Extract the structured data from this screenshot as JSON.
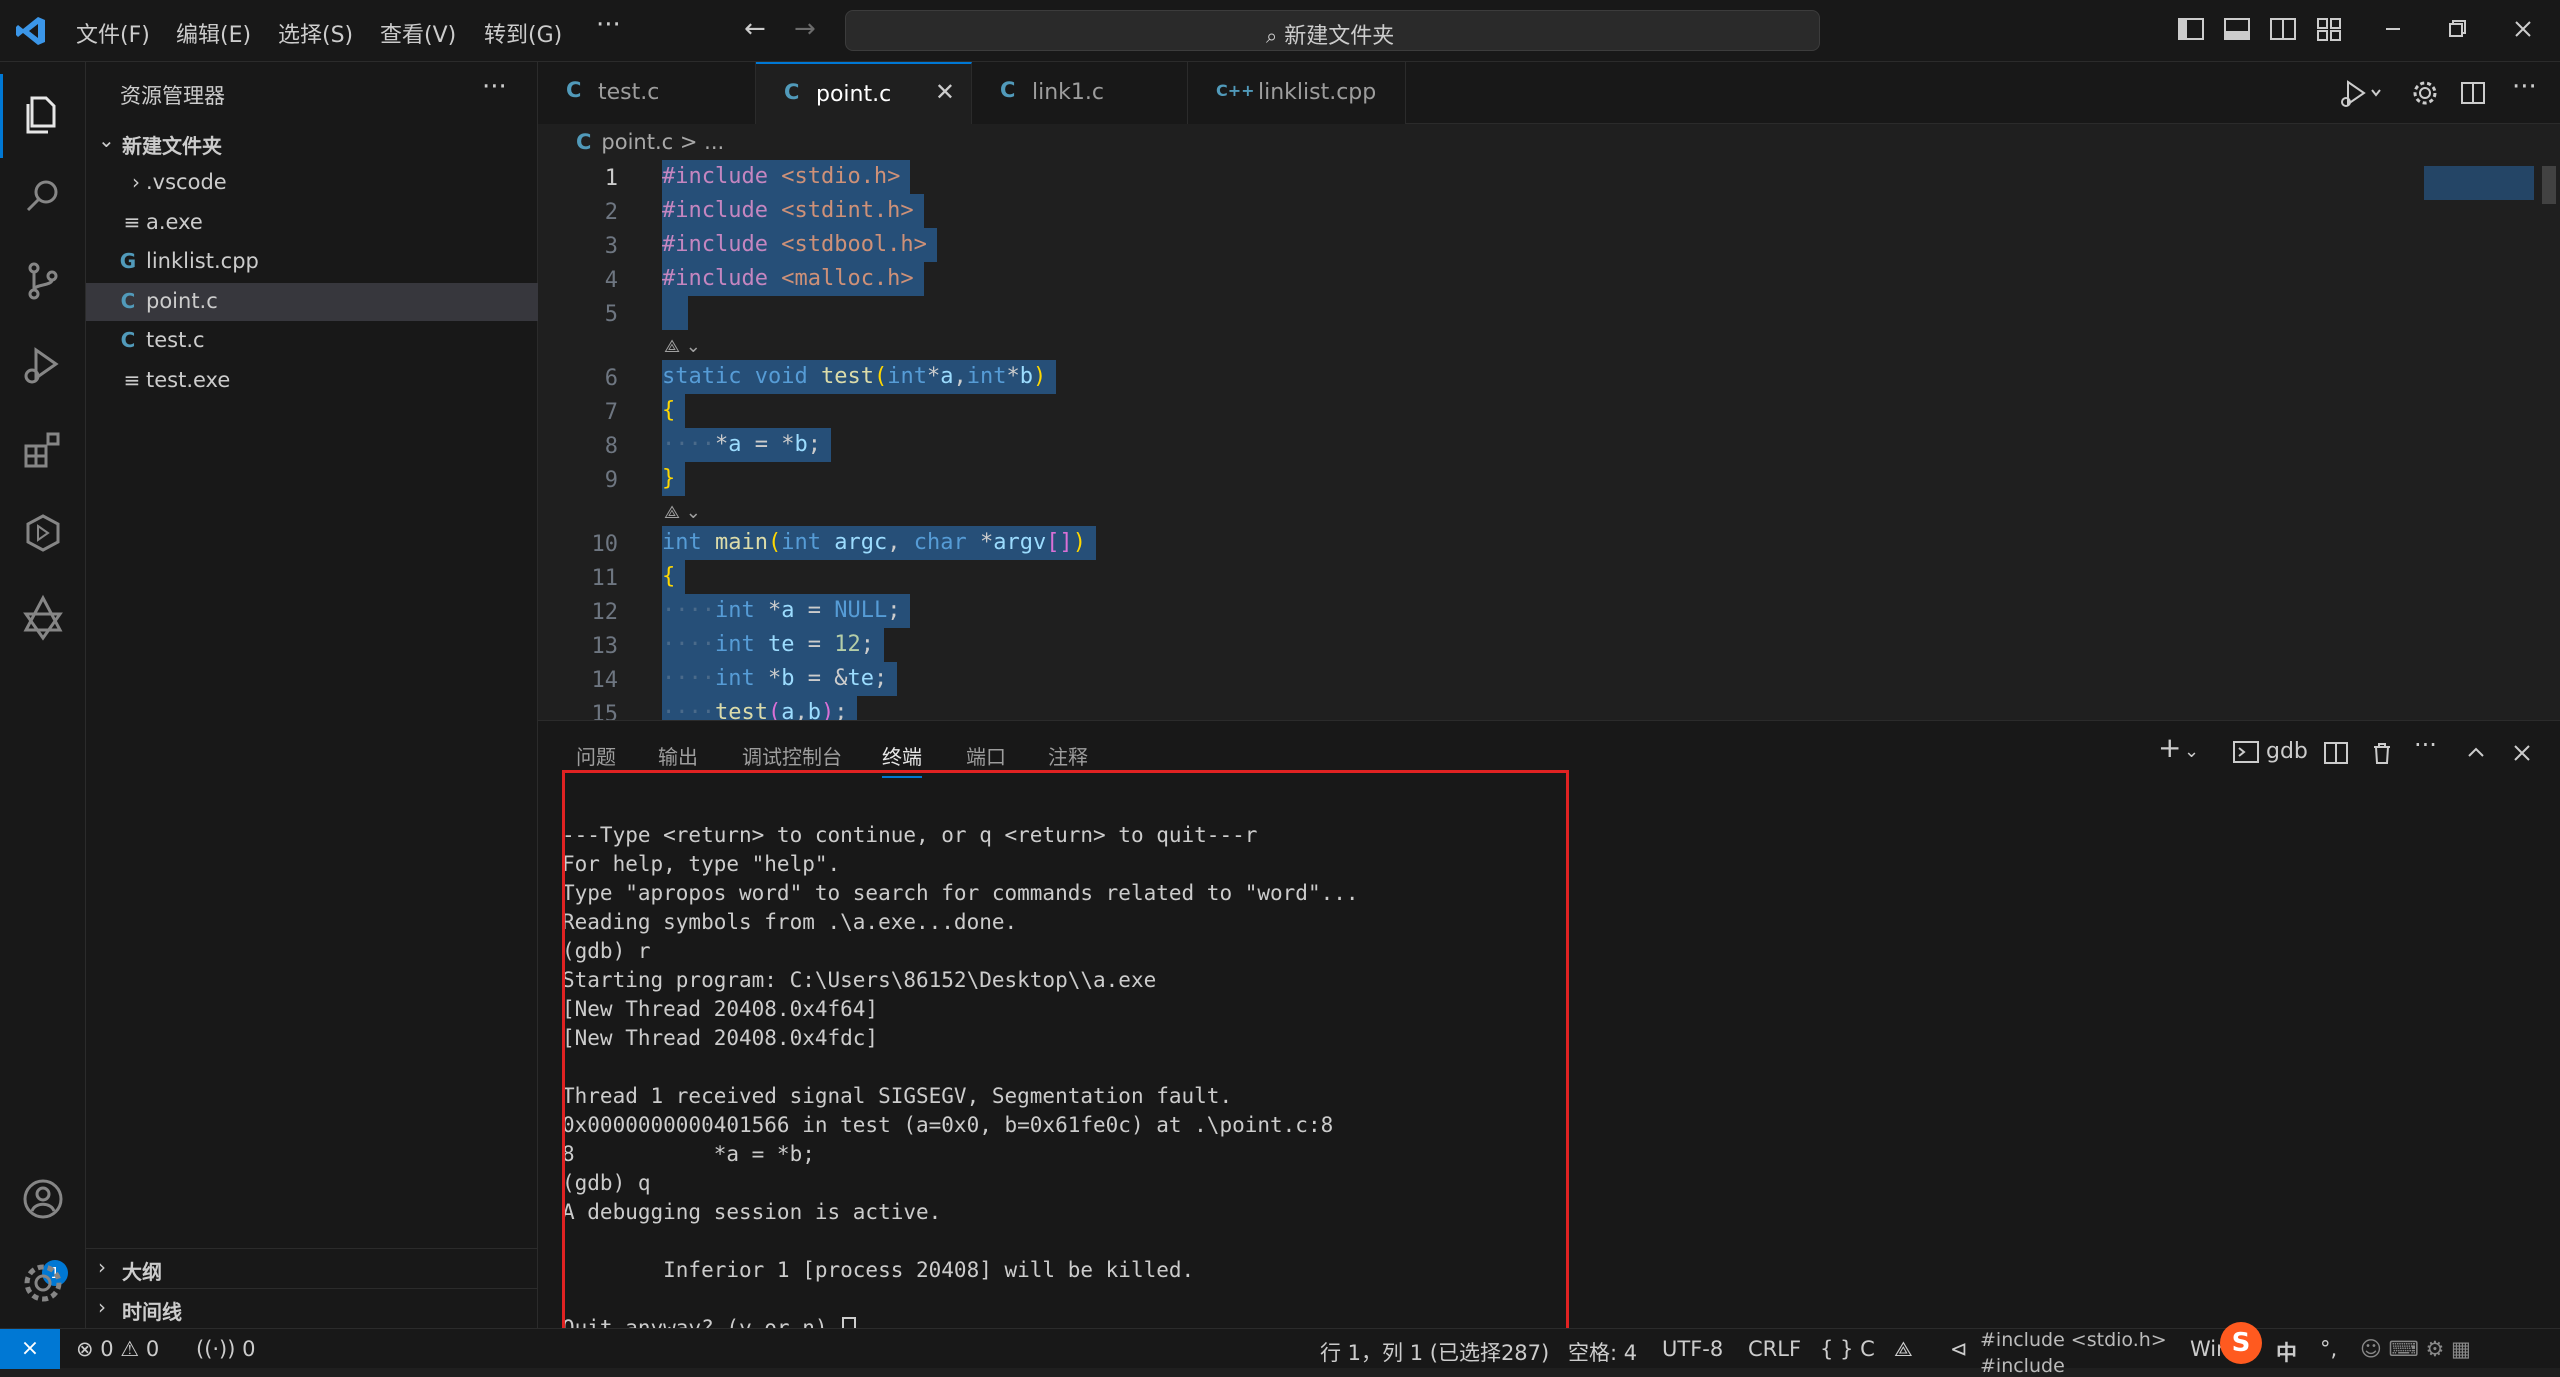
{
  "menu": [
    "文件(F)",
    "编辑(E)",
    "选择(S)",
    "查看(V)",
    "转到(G)"
  ],
  "search_text": "新建文件夹",
  "explorer": {
    "title": "资源管理器",
    "folder": "新建文件夹",
    "files": [
      {
        "name": ".vscode",
        "type": "folder"
      },
      {
        "name": "a.exe",
        "type": "file"
      },
      {
        "name": "linklist.cpp",
        "type": "cpp"
      },
      {
        "name": "point.c",
        "type": "c"
      },
      {
        "name": "test.c",
        "type": "c"
      },
      {
        "name": "test.exe",
        "type": "file"
      }
    ],
    "outline_label": "大纲",
    "timeline_label": "时间线"
  },
  "tabs": [
    {
      "label": "test.c",
      "icon": "C"
    },
    {
      "label": "point.c",
      "icon": "C"
    },
    {
      "label": "link1.c",
      "icon": "C"
    },
    {
      "label": "linklist.cpp",
      "icon": "C++"
    }
  ],
  "breadcrumb": {
    "file": "point.c",
    "rest": "> ..."
  },
  "line_numbers": [
    "1",
    "2",
    "3",
    "4",
    "5",
    "6",
    "7",
    "8",
    "9",
    "10",
    "11",
    "12",
    "13",
    "14",
    "15"
  ],
  "panel": {
    "tabs": [
      "问题",
      "输出",
      "调试控制台",
      "终端",
      "端口",
      "注释"
    ],
    "terminal_name": "gdb",
    "terminal_lines": [
      "---Type <return> to continue, or q <return> to quit---r",
      "For help, type \"help\".",
      "Type \"apropos word\" to search for commands related to \"word\"...",
      "Reading symbols from .\\a.exe...done.",
      "(gdb) r",
      "Starting program: C:\\Users\\86152\\Desktop\\\\a.exe",
      "[New Thread 20408.0x4f64]",
      "[New Thread 20408.0x4fdc]",
      "",
      "Thread 1 received signal SIGSEGV, Segmentation fault.",
      "0x0000000000401566 in test (a=0x0, b=0x61fe0c) at .\\point.c:8",
      "8           *a = *b;",
      "(gdb) q",
      "A debugging session is active.",
      "",
      "        Inferior 1 [process 20408] will be killed.",
      "",
      "Quit anyway? (y or n) "
    ]
  },
  "status": {
    "errors": "0",
    "warnings": "0",
    "ports": "0",
    "position": "行 1，列 1 (已选择287)",
    "spaces": "空格: 4",
    "encoding": "UTF-8",
    "eol": "CRLF",
    "language": "{ } C",
    "hover_preview": "#include <stdio.h>",
    "hover_preview2": "#include",
    "win": "Win",
    "ime": "S",
    "ime_text": "中",
    "account_badge": "1"
  }
}
